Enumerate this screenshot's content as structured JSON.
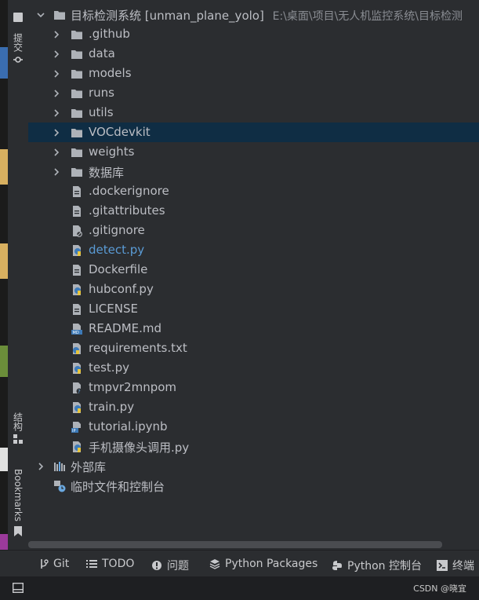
{
  "left_strip": {
    "commit_label": "提交",
    "structure_label": "结构",
    "bookmarks_label": "Bookmarks"
  },
  "tree": {
    "root": {
      "name": "目标检测系统 [unman_plane_yolo]",
      "path": "E:\\桌面\\项目\\无人机监控系统\\目标检测"
    },
    "items": [
      {
        "label": ".github",
        "type": "folder"
      },
      {
        "label": "data",
        "type": "folder"
      },
      {
        "label": "models",
        "type": "folder"
      },
      {
        "label": "runs",
        "type": "folder"
      },
      {
        "label": "utils",
        "type": "folder"
      },
      {
        "label": "VOCdevkit",
        "type": "folder",
        "selected": true
      },
      {
        "label": "weights",
        "type": "folder"
      },
      {
        "label": "数据库",
        "type": "folder"
      },
      {
        "label": ".dockerignore",
        "type": "file"
      },
      {
        "label": ".gitattributes",
        "type": "file"
      },
      {
        "label": ".gitignore",
        "type": "file-ignore"
      },
      {
        "label": "detect.py",
        "type": "python",
        "modified": true
      },
      {
        "label": "Dockerfile",
        "type": "file"
      },
      {
        "label": "hubconf.py",
        "type": "python"
      },
      {
        "label": "LICENSE",
        "type": "file"
      },
      {
        "label": "README.md",
        "type": "markdown"
      },
      {
        "label": "requirements.txt",
        "type": "requirements"
      },
      {
        "label": "test.py",
        "type": "python"
      },
      {
        "label": "tmpvr2mnpom",
        "type": "unknown"
      },
      {
        "label": "train.py",
        "type": "python"
      },
      {
        "label": "tutorial.ipynb",
        "type": "notebook"
      },
      {
        "label": "手机摄像头调用.py",
        "type": "python"
      }
    ],
    "external_libs": "外部库",
    "scratches": "临时文件和控制台"
  },
  "bottom_tabs": {
    "git": "Git",
    "todo": "TODO",
    "problems": "问题",
    "python_packages": "Python Packages",
    "python_console": "Python 控制台",
    "terminal": "终端"
  },
  "watermark": "CSDN @晓宜",
  "colors": {
    "background": "#2b2d30",
    "selected_row": "#0f2d44",
    "text": "#bcbec4",
    "modified_file": "#5a9bd5",
    "folder_icon": "#aeb2b8"
  }
}
